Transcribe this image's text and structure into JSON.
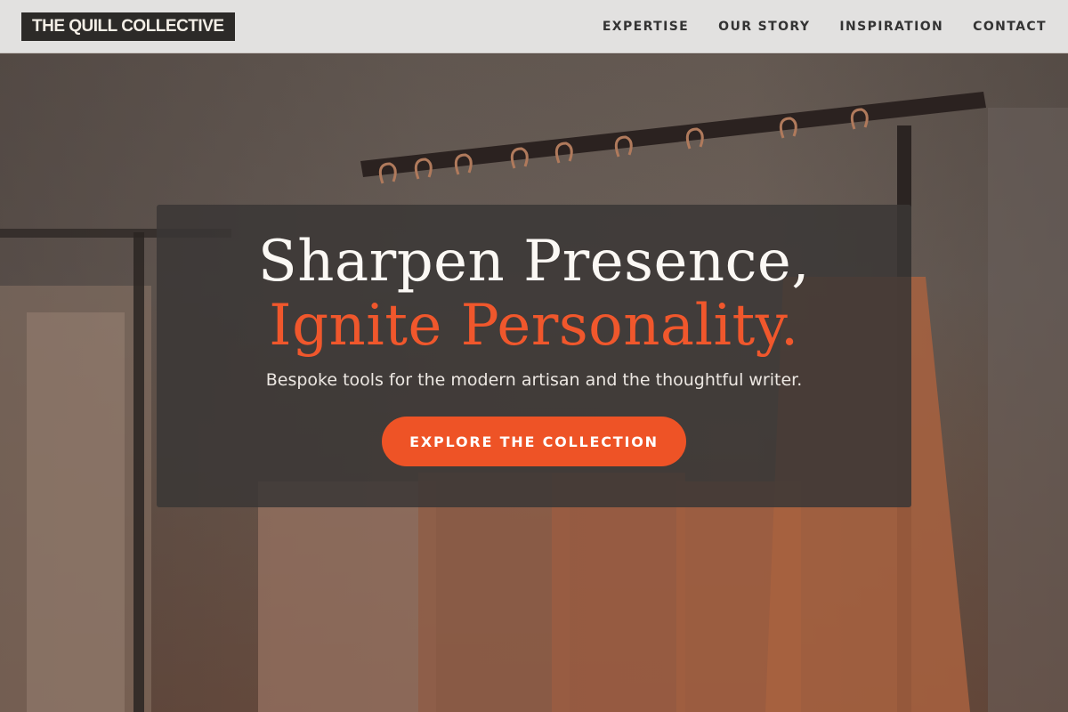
{
  "brand": {
    "logo_text": "THE QUILL COLLECTIVE"
  },
  "nav": {
    "items": [
      {
        "label": "EXPERTISE"
      },
      {
        "label": "OUR STORY"
      },
      {
        "label": "INSPIRATION"
      },
      {
        "label": "CONTACT"
      }
    ]
  },
  "hero": {
    "headline_line1": "Sharpen Presence,",
    "headline_line2": "Ignite Personality.",
    "subtitle": "Bespoke tools for the modern artisan and the thoughtful writer.",
    "cta_label": "EXPLORE THE COLLECTION",
    "background_image": "clothing-rack-photo"
  },
  "colors": {
    "accent": "#ee5326",
    "header_bg": "#e2e1e0",
    "logo_bg": "#2c2a28",
    "card_bg": "#3a3735"
  }
}
